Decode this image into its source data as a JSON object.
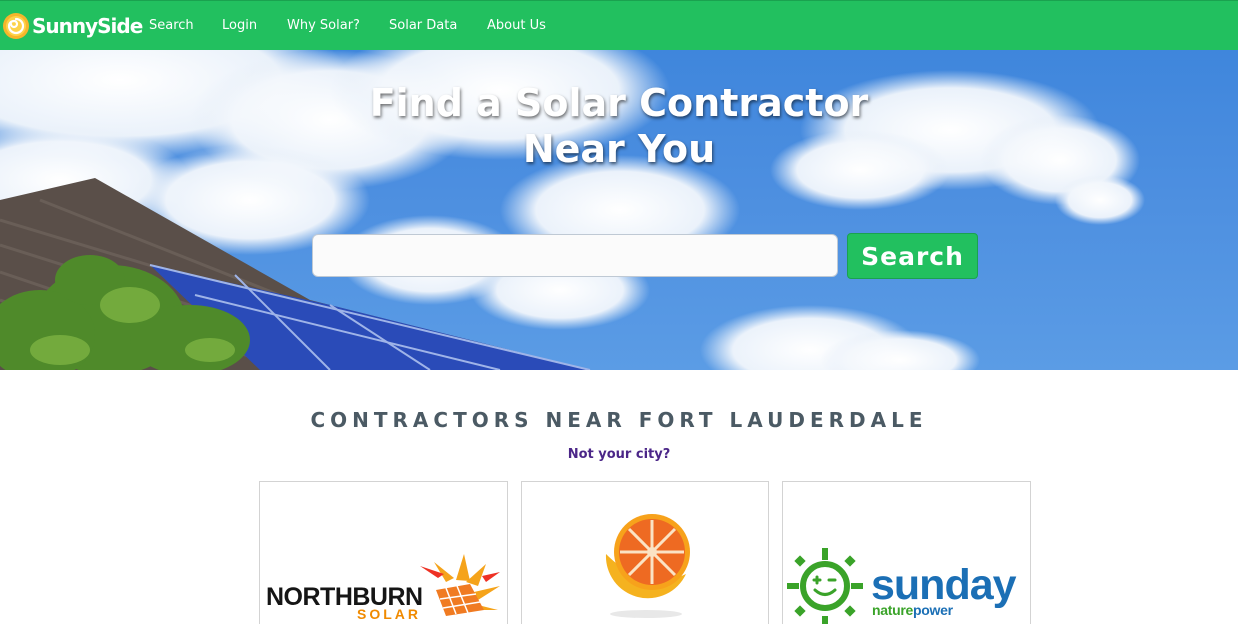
{
  "brand": {
    "name": "SunnySide",
    "icon": "sun-swirl-logo-icon"
  },
  "nav": {
    "items": [
      {
        "label": "Search"
      },
      {
        "label": "Login"
      },
      {
        "label": "Why Solar?"
      },
      {
        "label": "Solar Data"
      },
      {
        "label": "About Us"
      }
    ]
  },
  "hero": {
    "title_line1": "Find a Solar Contractor",
    "title_line2": "Near You",
    "search_value": "",
    "search_button": "Search"
  },
  "contractors": {
    "heading": "CONTRACTORS NEAR FORT LAUDERDALE",
    "not_your_city": "Not your city?",
    "cards": [
      {
        "name": "NORTHBURN",
        "sub": "SOLAR",
        "icon": "sunburst-panel-logo-icon"
      },
      {
        "name": "",
        "icon": "orange-slice-logo-icon"
      },
      {
        "name": "sunday",
        "sub_part1": "nature",
        "sub_part2": "power",
        "icon": "smiling-sun-logo-icon"
      }
    ]
  },
  "colors": {
    "brand_green": "#22c05f",
    "sky_blue": "#4d8fe0",
    "heading_gray": "#4b5a64",
    "link_purple": "#4b2688"
  }
}
